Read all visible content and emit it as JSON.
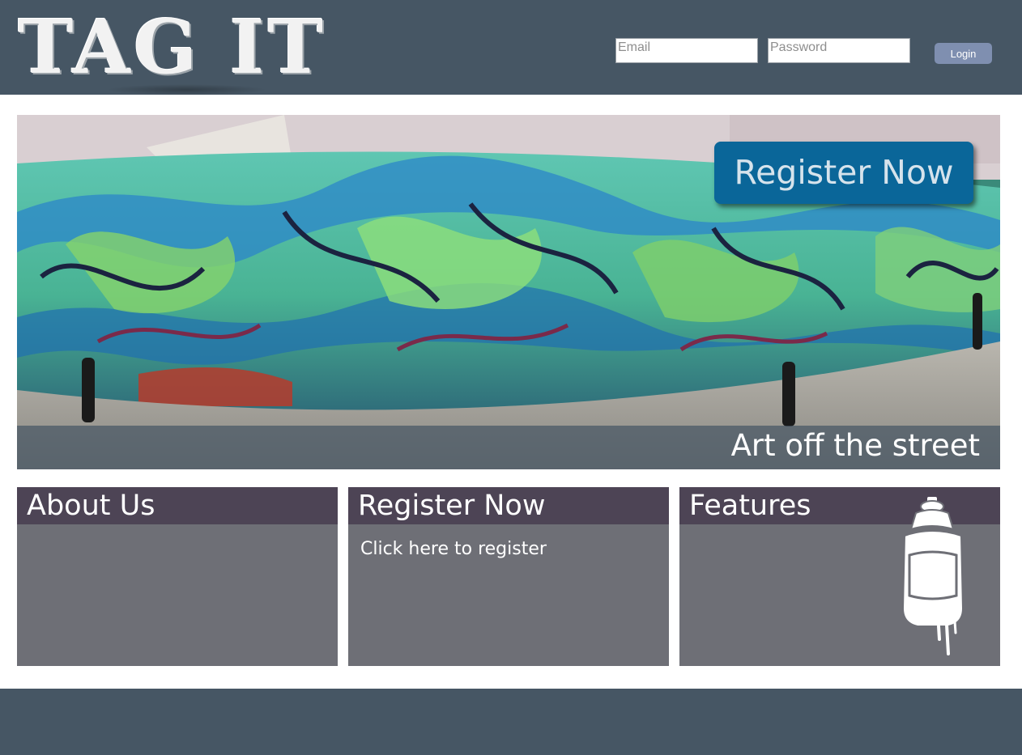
{
  "header": {
    "logo_text": "TAG IT",
    "email_placeholder": "Email",
    "password_placeholder": "Password",
    "login_label": "Login"
  },
  "hero": {
    "image_icon": "graffiti-wall-photo",
    "register_label": "Register Now",
    "caption": "Art off the street"
  },
  "cards": [
    {
      "title": "About Us"
    },
    {
      "title": "Register Now",
      "link_text": "Click here to register"
    },
    {
      "title": "Features",
      "icon": "spray-can-icon"
    }
  ],
  "colors": {
    "header_bg": "#465664",
    "register_button": "#0a6699",
    "card_header": "#4d4455",
    "card_body": "#6e6f76",
    "login_button": "#7f8fb0"
  }
}
